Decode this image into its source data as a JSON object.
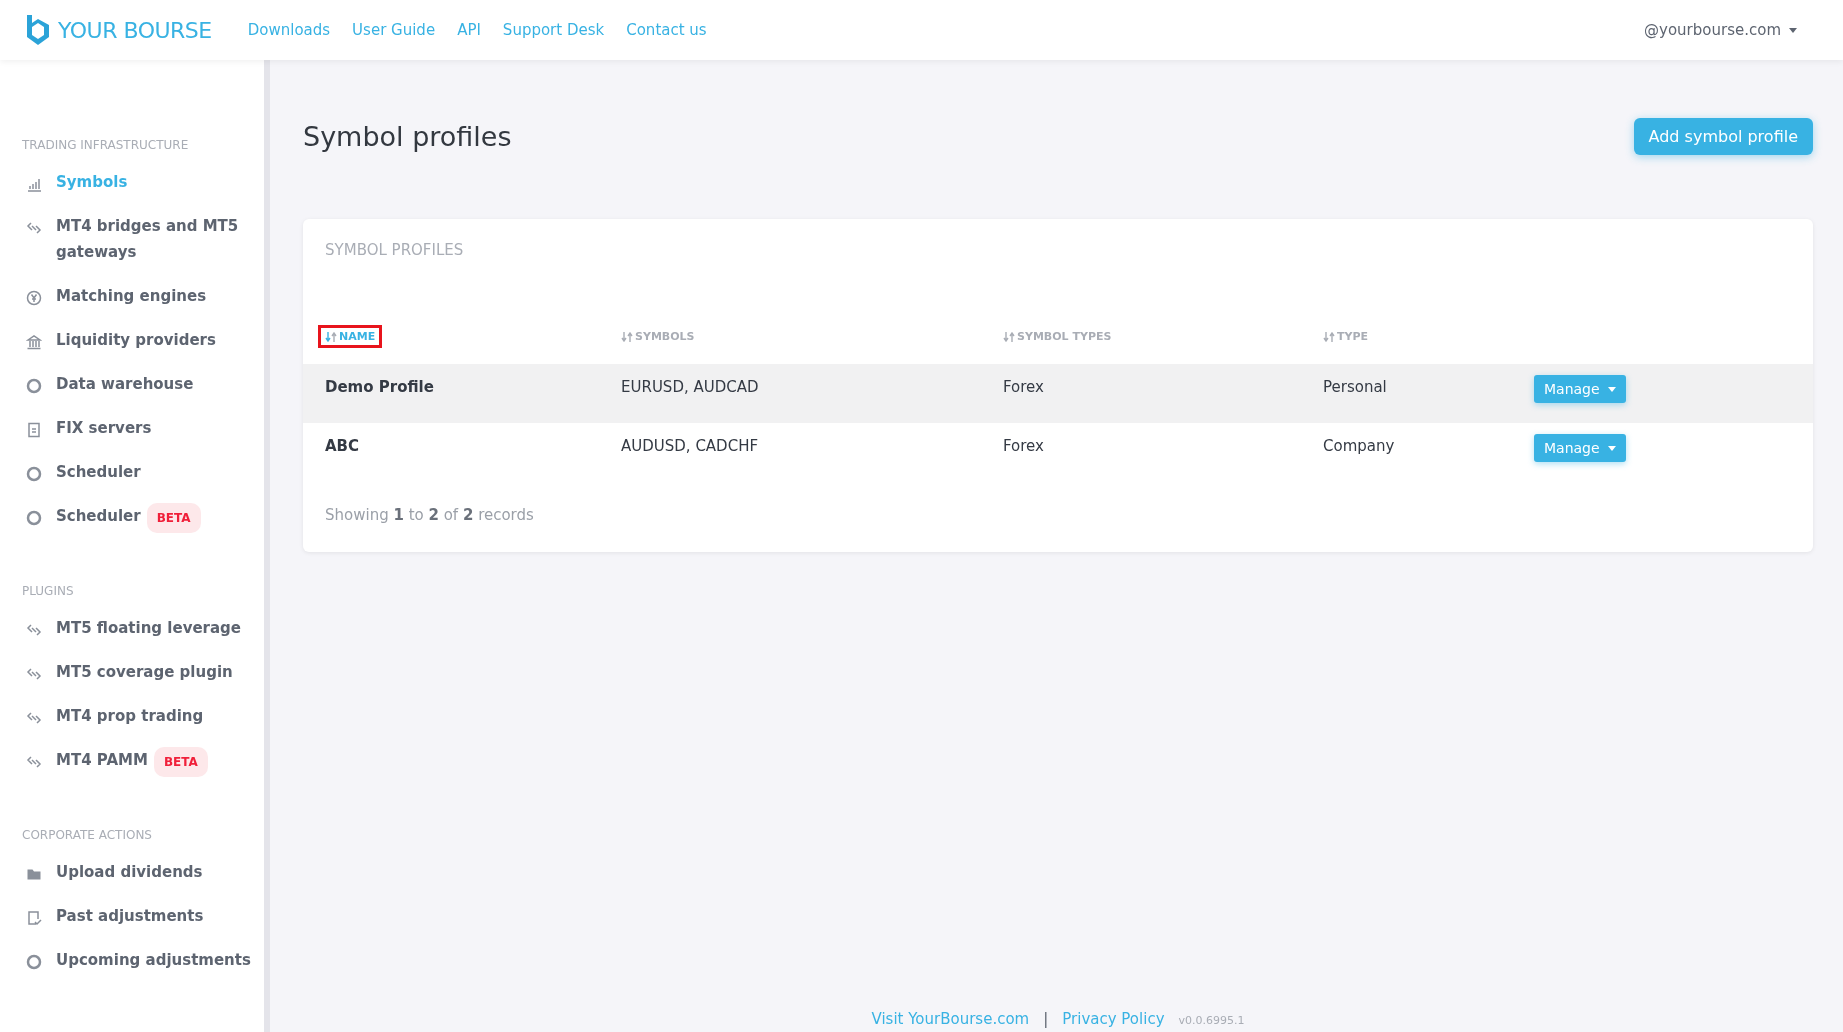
{
  "header": {
    "logo": "YOUR BOURSE",
    "nav": [
      "Downloads",
      "User Guide",
      "API",
      "Support Desk",
      "Contact us"
    ],
    "account": "@yourbourse.com"
  },
  "sidebar": {
    "sections": [
      {
        "title": "TRADING INFRASTRUCTURE",
        "items": [
          {
            "label": "Symbols",
            "kind": "bars",
            "selected": true
          },
          {
            "label": "MT4 bridges and MT5 gateways",
            "kind": "link",
            "selected": false
          },
          {
            "label": "Matching engines",
            "kind": "yen",
            "selected": false
          },
          {
            "label": "Liquidity providers",
            "kind": "bank",
            "selected": false
          },
          {
            "label": "Data warehouse",
            "kind": "ring",
            "selected": false
          },
          {
            "label": "FIX servers",
            "kind": "doc",
            "selected": false
          },
          {
            "label": "Scheduler",
            "kind": "ring",
            "selected": false
          },
          {
            "label": "Scheduler",
            "kind": "ring",
            "selected": false,
            "badge": "BETA"
          }
        ]
      },
      {
        "title": "PLUGINS",
        "items": [
          {
            "label": "MT5 floating leverage",
            "kind": "link",
            "selected": false
          },
          {
            "label": "MT5 coverage plugin",
            "kind": "link",
            "selected": false
          },
          {
            "label": "MT4 prop trading",
            "kind": "link",
            "selected": false
          },
          {
            "label": "MT4 PAMM",
            "kind": "link",
            "selected": false,
            "badge": "BETA"
          }
        ]
      },
      {
        "title": "CORPORATE ACTIONS",
        "items": [
          {
            "label": "Upload dividends",
            "kind": "folder",
            "selected": false
          },
          {
            "label": "Past adjustments",
            "kind": "check",
            "selected": false
          },
          {
            "label": "Upcoming adjustments",
            "kind": "ring",
            "selected": false
          }
        ]
      }
    ]
  },
  "page": {
    "title": "Symbol profiles",
    "add_button": "Add symbol profile"
  },
  "table": {
    "title": "SYMBOL PROFILES",
    "columns": [
      {
        "label": "NAME",
        "sorted": true,
        "highlighted": true
      },
      {
        "label": "SYMBOLS",
        "sorted": false,
        "highlighted": false
      },
      {
        "label": "SYMBOL TYPES",
        "sorted": false,
        "highlighted": false
      },
      {
        "label": "TYPE",
        "sorted": false,
        "highlighted": false
      }
    ],
    "rows": [
      {
        "name": "Demo Profile",
        "symbols": "EURUSD, AUDCAD",
        "symbol_types": "Forex",
        "type": "Personal",
        "action": "Manage"
      },
      {
        "name": "ABC",
        "symbols": "AUDUSD, CADCHF",
        "symbol_types": "Forex",
        "type": "Company",
        "action": "Manage"
      }
    ],
    "summary": "Showing **1** to **2** of **2** records"
  },
  "footer": {
    "links": [
      "Visit YourBourse.com",
      "Privacy Policy"
    ],
    "separator": "|",
    "version": "v0.0.6995.1"
  }
}
